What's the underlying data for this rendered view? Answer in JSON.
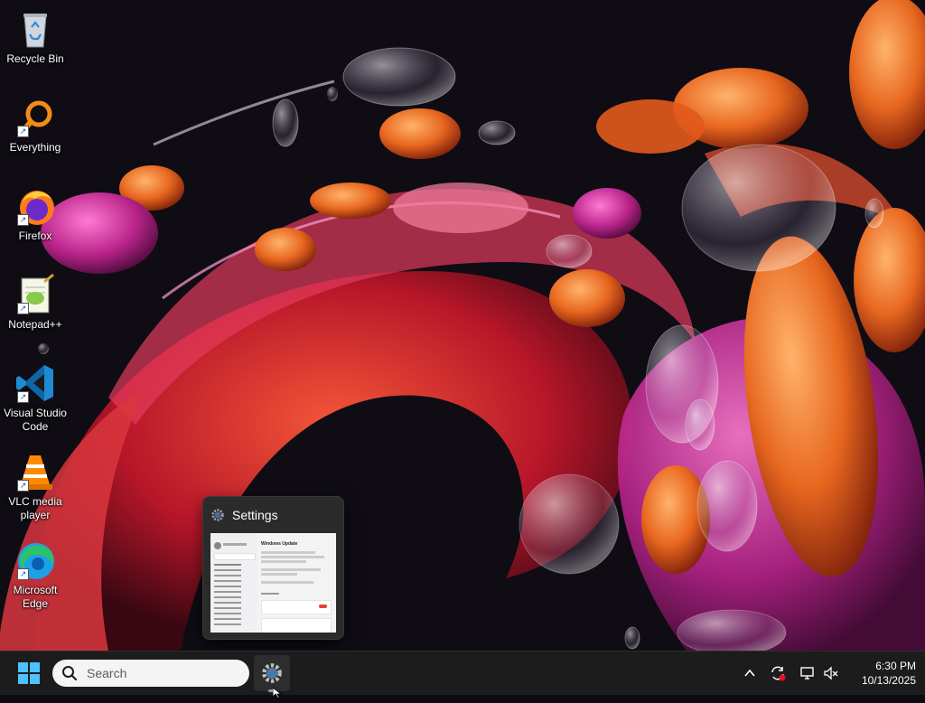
{
  "desktop": {
    "icons": [
      {
        "label": "Recycle Bin",
        "icon": "recycle-bin-icon"
      },
      {
        "label": "Everything",
        "icon": "everything-search-icon"
      },
      {
        "label": "Firefox",
        "icon": "firefox-icon"
      },
      {
        "label": "Notepad++",
        "icon": "notepad-plus-plus-icon"
      },
      {
        "label": "Visual Studio Code",
        "icon": "vscode-icon"
      },
      {
        "label": "VLC media player",
        "icon": "vlc-icon"
      },
      {
        "label": "Microsoft Edge",
        "icon": "edge-icon"
      }
    ]
  },
  "preview": {
    "title": "Settings",
    "icon": "settings-gear-icon",
    "thumbnail_heading": "Windows Update"
  },
  "taskbar": {
    "search_placeholder": "Search",
    "pinned_app": "Settings",
    "tray": {
      "icons": [
        "chevron-up-icon",
        "sync-icon",
        "network-icon",
        "volume-muted-icon"
      ]
    },
    "clock": {
      "time": "6:30 PM",
      "date": "10/13/2025"
    }
  },
  "colors": {
    "taskbar": "#1c1c1c",
    "accent_orange": "#e8671f",
    "accent_pink": "#c2277a",
    "windows_blue": "#0078d4"
  }
}
